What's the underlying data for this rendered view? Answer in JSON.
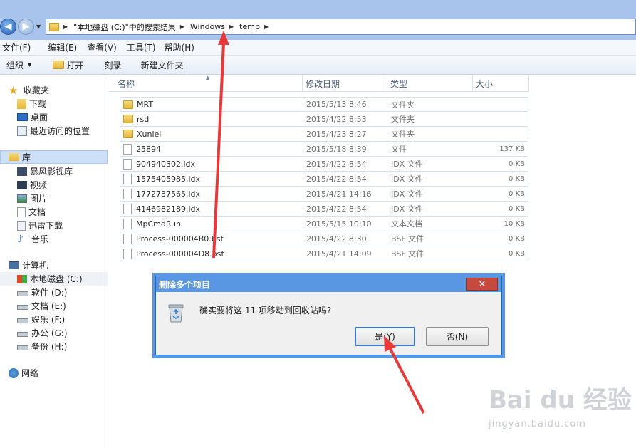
{
  "address": {
    "crumbs": [
      "\"本地磁盘 (C:)\"中的搜索结果",
      "Windows",
      "temp"
    ]
  },
  "menu": [
    "文件(F)",
    "编辑(E)",
    "查看(V)",
    "工具(T)",
    "帮助(H)"
  ],
  "toolbar": {
    "organize": "组织",
    "open": "打开",
    "burn": "刻录",
    "new_folder": "新建文件夹"
  },
  "sidebar": {
    "favorites": "收藏夹",
    "fav_items": [
      "下载",
      "桌面",
      "最近访问的位置"
    ],
    "library": "库",
    "lib_items": [
      "暴风影视库",
      "视频",
      "图片",
      "文档",
      "迅雷下载",
      "音乐"
    ],
    "computer": "计算机",
    "drives": [
      "本地磁盘 (C:)",
      "软件 (D:)",
      "文档 (E:)",
      "娱乐 (F:)",
      "办公 (G:)",
      "备份 (H:)"
    ],
    "network": "网络"
  },
  "columns": {
    "name": "名称",
    "date": "修改日期",
    "type": "类型",
    "size": "大小"
  },
  "files": [
    {
      "name": "MRT",
      "date": "2015/5/13 8:46",
      "type": "文件夹",
      "size": "",
      "folder": true
    },
    {
      "name": "rsd",
      "date": "2015/4/22 8:53",
      "type": "文件夹",
      "size": "",
      "folder": true
    },
    {
      "name": "Xunlei",
      "date": "2015/4/23 8:27",
      "type": "文件夹",
      "size": "",
      "folder": true
    },
    {
      "name": "25894",
      "date": "2015/5/18 8:39",
      "type": "文件",
      "size": "137 KB",
      "folder": false
    },
    {
      "name": "904940302.idx",
      "date": "2015/4/22 8:54",
      "type": "IDX 文件",
      "size": "0 KB",
      "folder": false
    },
    {
      "name": "1575405985.idx",
      "date": "2015/4/22 8:54",
      "type": "IDX 文件",
      "size": "0 KB",
      "folder": false
    },
    {
      "name": "1772737565.idx",
      "date": "2015/4/21 14:16",
      "type": "IDX 文件",
      "size": "0 KB",
      "folder": false
    },
    {
      "name": "4146982189.idx",
      "date": "2015/4/22 8:54",
      "type": "IDX 文件",
      "size": "0 KB",
      "folder": false
    },
    {
      "name": "MpCmdRun",
      "date": "2015/5/15 10:10",
      "type": "文本文档",
      "size": "10 KB",
      "folder": false
    },
    {
      "name": "Process-000004B0.bsf",
      "date": "2015/4/22 8:30",
      "type": "BSF 文件",
      "size": "0 KB",
      "folder": false
    },
    {
      "name": "Process-000004D8.bsf",
      "date": "2015/4/21 14:09",
      "type": "BSF 文件",
      "size": "0 KB",
      "folder": false
    }
  ],
  "dialog": {
    "title": "删除多个项目",
    "message": "确实要将这 11 项移动到回收站吗?",
    "yes": "是(Y)",
    "no": "否(N)",
    "close": "✕"
  },
  "watermark": {
    "brand": "Bai du 经验",
    "url": "jingyan.baidu.com"
  },
  "colors": {
    "accent": "#5a97e2",
    "arrow": "#e8393a"
  }
}
